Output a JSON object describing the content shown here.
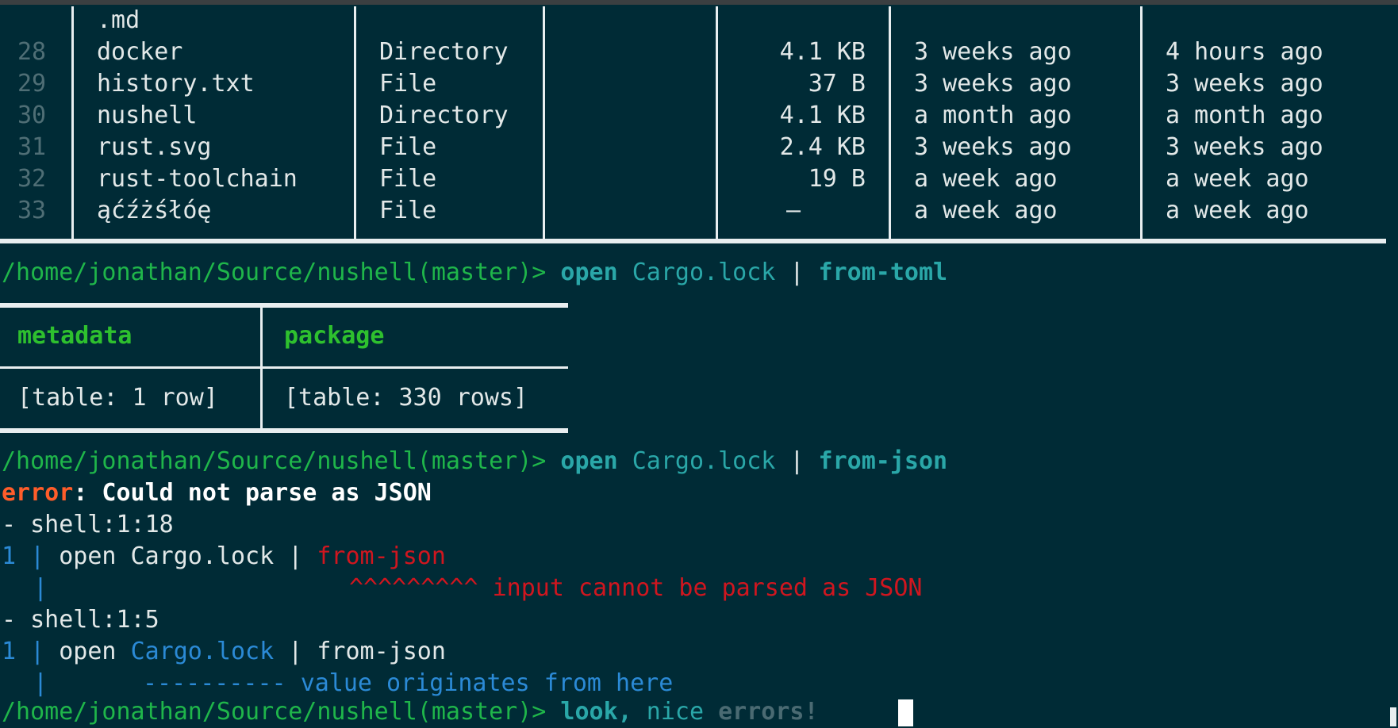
{
  "ls_table": {
    "partial_name": ".md",
    "rows": [
      {
        "index": "28",
        "name": "docker",
        "type": "Directory",
        "readonly": "",
        "size": "4.1 KB",
        "accessed": "3 weeks ago",
        "modified": "4 hours ago"
      },
      {
        "index": "29",
        "name": "history.txt",
        "type": "File",
        "readonly": "",
        "size": "37 B",
        "accessed": "3 weeks ago",
        "modified": "3 weeks ago"
      },
      {
        "index": "30",
        "name": "nushell",
        "type": "Directory",
        "readonly": "",
        "size": "4.1 KB",
        "accessed": "a month ago",
        "modified": "a month ago"
      },
      {
        "index": "31",
        "name": "rust.svg",
        "type": "File",
        "readonly": "",
        "size": "2.4 KB",
        "accessed": "3 weeks ago",
        "modified": "3 weeks ago"
      },
      {
        "index": "32",
        "name": "rust-toolchain",
        "type": "File",
        "readonly": "",
        "size": "19 B",
        "accessed": "a week ago",
        "modified": "a week ago"
      },
      {
        "index": "33",
        "name": "ąćźżśłóę",
        "type": "File",
        "readonly": "",
        "size": "—",
        "accessed": "a week ago",
        "modified": "a week ago"
      }
    ]
  },
  "prompt1": {
    "path": "/home/jonathan/Source/nushell(master)> ",
    "cmd": "open",
    "arg": "Cargo.lock",
    "pipe": " | ",
    "cmd2": "from-toml"
  },
  "toml_table": {
    "headers": [
      "metadata",
      "package"
    ],
    "values": [
      "[table: 1 row]",
      "[table: 330 rows]"
    ]
  },
  "prompt2": {
    "path": "/home/jonathan/Source/nushell(master)> ",
    "cmd": "open",
    "arg": "Cargo.lock",
    "pipe": " | ",
    "cmd2": "from-json"
  },
  "error": {
    "label": "error",
    "message": ": Could not parse as JSON",
    "loc1": "- shell:1:18",
    "line1_num": "1",
    "line1_sep": " | ",
    "line1_pre": "open Cargo.lock | ",
    "line1_hl": "from-json",
    "caret_bar": "|",
    "carets": "^^^^^^^^^",
    "caret_msg": "input cannot be parsed as JSON",
    "loc2": "- shell:1:5",
    "line2_num": "1",
    "line2_sep": " | ",
    "line2_pre": "open ",
    "line2_hl": "Cargo.lock",
    "line2_post": " | from-json",
    "dash_bar": "|",
    "dashes": "----------",
    "dash_msg": "value originates from here"
  },
  "prompt3": {
    "path": "/home/jonathan/Source/nushell(master)> ",
    "word1": "look,",
    "word2": "nice",
    "word3": "errors!"
  }
}
